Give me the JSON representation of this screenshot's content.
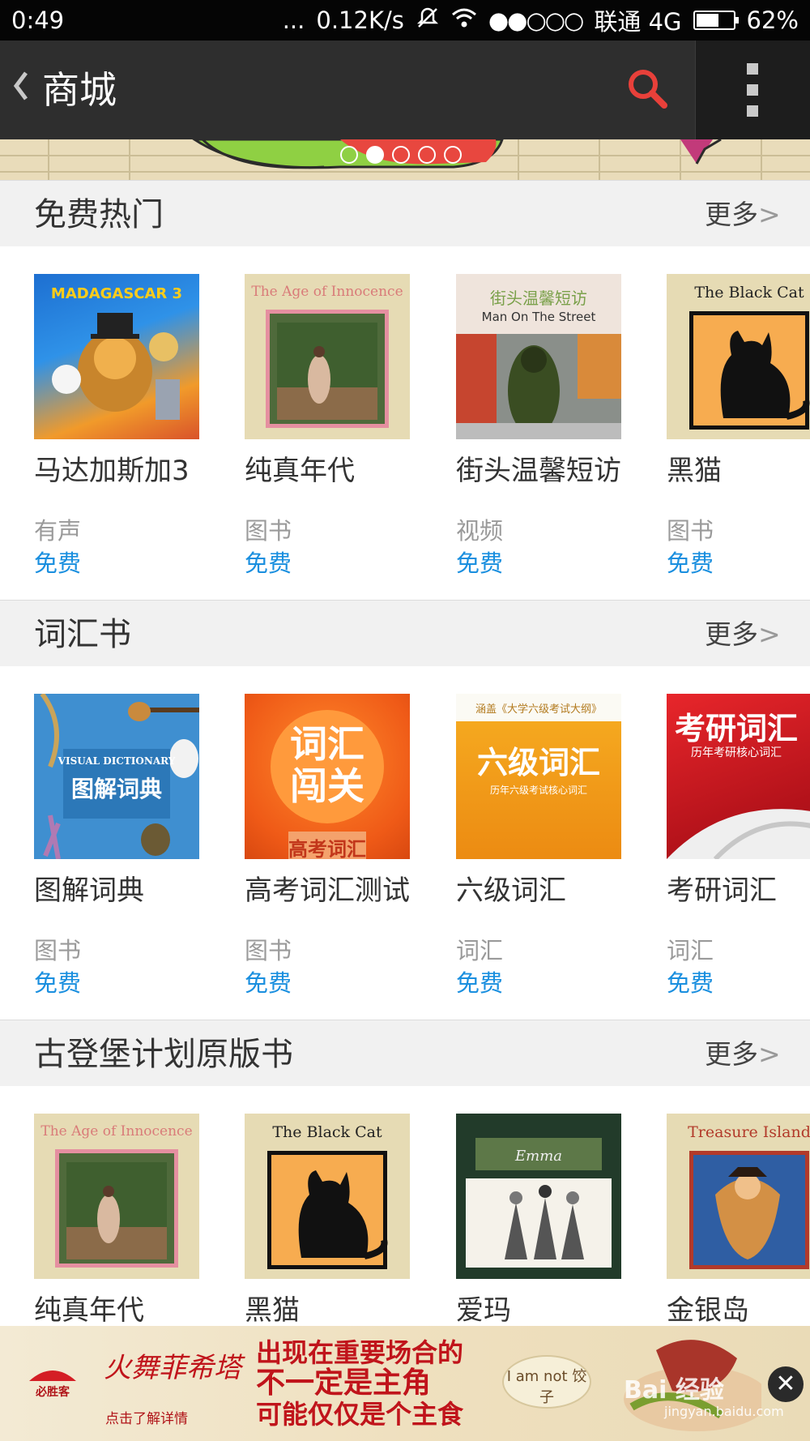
{
  "status_bar": {
    "time": "0:49",
    "dots": "...",
    "speed": "0.12K/s",
    "carrier": "联通 4G",
    "battery": "62%",
    "battery_level": 0.62
  },
  "app_bar": {
    "back_glyph": "《",
    "title": "商城"
  },
  "banner": {
    "pages": 5,
    "active_page": 2
  },
  "sections": [
    {
      "title": "免费热门",
      "more": "更多",
      "items": [
        {
          "name": "马达加斯加3",
          "type": "有声",
          "price": "免费",
          "cover_text": "MADAGASCAR 3"
        },
        {
          "name": "纯真年代",
          "type": "图书",
          "price": "免费",
          "cover_text": "The Age of Innocence"
        },
        {
          "name": "街头温馨短访",
          "type": "视频",
          "price": "免费",
          "cover_text": "街头温馨短访",
          "cover_sub": "Man On The Street"
        },
        {
          "name": "黑猫",
          "type": "图书",
          "price": "免费",
          "cover_text": "The Black Cat"
        }
      ]
    },
    {
      "title": "词汇书",
      "more": "更多",
      "items": [
        {
          "name": "图解词典",
          "type": "图书",
          "price": "免费",
          "cover_text": "图解词典",
          "cover_sub": "VISUAL DICTIONARY"
        },
        {
          "name": "高考词汇测试",
          "type": "图书",
          "price": "免费",
          "cover_text": "词汇闯关",
          "cover_sub": "高考词汇"
        },
        {
          "name": "六级词汇",
          "type": "词汇",
          "price": "免费",
          "cover_text": "六级词汇",
          "cover_sub": "历年六级考试核心词汇",
          "cover_top": "涵盖《大学六级考试大纲》"
        },
        {
          "name": "考研词汇",
          "type": "词汇",
          "price": "免费",
          "cover_text": "考研词汇",
          "cover_sub": "历年考研核心词汇"
        }
      ]
    },
    {
      "title": "古登堡计划原版书",
      "more": "更多",
      "items": [
        {
          "name": "纯真年代",
          "cover_text": "The Age of Innocence"
        },
        {
          "name": "黑猫",
          "cover_text": "The Black Cat"
        },
        {
          "name": "爱玛",
          "cover_text": "Emma"
        },
        {
          "name": "金银岛",
          "cover_text": "Treasure Island"
        }
      ]
    }
  ],
  "ad": {
    "script": "火舞菲希塔",
    "line1": "出现在重要场合的",
    "line2": "不一定是主角",
    "line3": "可能仅仅是个主食",
    "tag": "点击了解详情",
    "bubble": "I am not 饺子",
    "logo_text": "必胜客"
  },
  "watermark": {
    "text": "Bai 经验",
    "sub": "jingyan.baidu.com"
  },
  "colors": {
    "accent_blue": "#1a8fdf",
    "search_red": "#e8403a",
    "app_bar": "#2e2e2e"
  }
}
